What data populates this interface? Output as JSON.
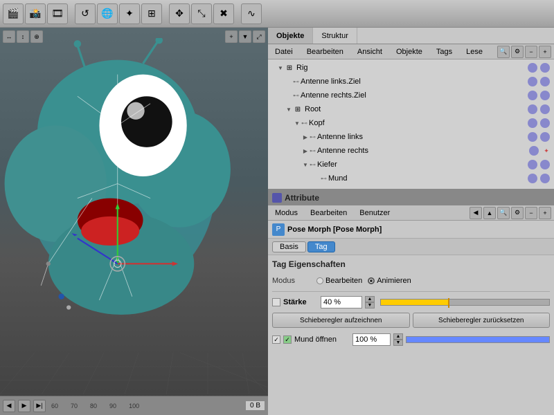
{
  "toolbar": {
    "icons": [
      "🎬",
      "📷",
      "🎥",
      "🔧",
      "🌐",
      "⭐",
      "🔲",
      "✖"
    ]
  },
  "viewport": {
    "timeline_marks": [
      "60",
      "70",
      "80",
      "90",
      "100"
    ],
    "status": "0 B"
  },
  "objects_panel": {
    "tabs": [
      {
        "label": "Objekte",
        "active": true
      },
      {
        "label": "Struktur",
        "active": false
      }
    ],
    "menu": [
      "Datei",
      "Bearbeiten",
      "Ansicht",
      "Objekte",
      "Tags",
      "Lese"
    ],
    "tree": [
      {
        "label": "Rig",
        "indent": 0,
        "has_arrow": true,
        "expanded": true,
        "icon": "⊞",
        "dots": false,
        "tag": false
      },
      {
        "label": "Antenne links.Ziel",
        "indent": 1,
        "has_arrow": false,
        "expanded": false,
        "icon": "⊷",
        "dots": true,
        "tag": false
      },
      {
        "label": "Antenne rechts.Ziel",
        "indent": 1,
        "has_arrow": false,
        "expanded": false,
        "icon": "⊷",
        "dots": true,
        "tag": false
      },
      {
        "label": "Root",
        "indent": 1,
        "has_arrow": true,
        "expanded": true,
        "icon": "⊞",
        "dots": true,
        "tag": false
      },
      {
        "label": "Kopf",
        "indent": 2,
        "has_arrow": true,
        "expanded": true,
        "icon": "⊷",
        "dots": true,
        "tag": false
      },
      {
        "label": "Antenne links",
        "indent": 3,
        "has_arrow": true,
        "expanded": false,
        "icon": "⊷",
        "dots": true,
        "tag": false
      },
      {
        "label": "Antenne rechts",
        "indent": 3,
        "has_arrow": true,
        "expanded": false,
        "icon": "⊷",
        "dots": true,
        "tag": true
      },
      {
        "label": "Kiefer",
        "indent": 3,
        "has_arrow": true,
        "expanded": true,
        "icon": "⊷",
        "dots": true,
        "tag": false
      },
      {
        "label": "Mund",
        "indent": 4,
        "has_arrow": false,
        "expanded": false,
        "icon": "⊷",
        "dots": true,
        "tag": false
      }
    ]
  },
  "attribute_panel": {
    "title": "Attribute",
    "menu": [
      "Modus",
      "Bearbeiten",
      "Benutzer"
    ],
    "pose_label": "Pose Morph [Pose Morph]",
    "tabs": [
      {
        "label": "Basis",
        "active": false
      },
      {
        "label": "Tag",
        "active": true
      }
    ],
    "section_title": "Tag Eigenschaften",
    "modus_label": "Modus",
    "radio_options": [
      {
        "label": "Bearbeiten",
        "checked": false
      },
      {
        "label": "Animieren",
        "checked": true
      }
    ],
    "strength": {
      "label": "Stärke",
      "value": "40 %",
      "bar_percent": 40,
      "btn1": "Schieberegler aufzeichnen",
      "btn2": "Schieberegler zurücksetzen"
    },
    "morphs": [
      {
        "name": "Mund öffnen",
        "value": "100 %",
        "bar_percent": 100
      }
    ]
  }
}
